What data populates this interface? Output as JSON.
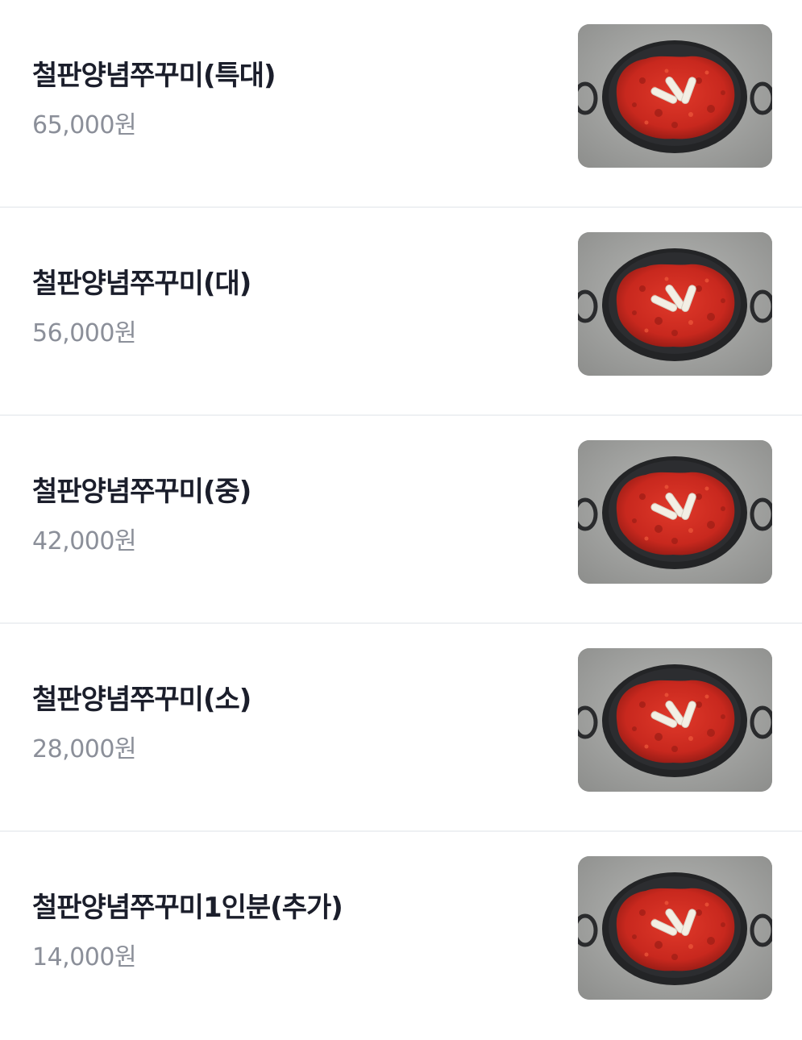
{
  "menu": {
    "items": [
      {
        "name": "철판양념쭈꾸미(특대)",
        "price": "65,000원",
        "image": "spicy-webfoot-octopus-pan-photo"
      },
      {
        "name": "철판양념쭈꾸미(대)",
        "price": "56,000원",
        "image": "spicy-webfoot-octopus-pan-photo"
      },
      {
        "name": "철판양념쭈꾸미(중)",
        "price": "42,000원",
        "image": "spicy-webfoot-octopus-pan-photo"
      },
      {
        "name": "철판양념쭈꾸미(소)",
        "price": "28,000원",
        "image": "spicy-webfoot-octopus-pan-photo"
      },
      {
        "name": "철판양념쭈꾸미1인분(추가)",
        "price": "14,000원",
        "image": "spicy-webfoot-octopus-pan-photo"
      }
    ]
  },
  "colors": {
    "name_text": "#1b1e2b",
    "price_text": "#8b8f99",
    "divider": "#eef0f3",
    "sauce_red": "#c8281e",
    "pan_black": "#222325",
    "counter_gray": "#a9aaa8"
  }
}
